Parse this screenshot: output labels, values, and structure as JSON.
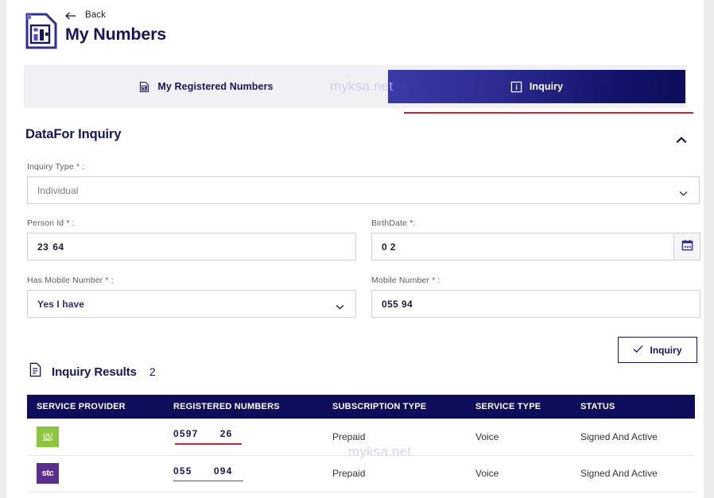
{
  "header": {
    "back_label": "Back",
    "title": "My Numbers",
    "doc_icon": "document-chart-icon",
    "back_icon": "arrow-left-icon"
  },
  "tabs": [
    {
      "label": "My Registered Numbers",
      "icon": "document-list-icon",
      "active": false
    },
    {
      "label": "Inquiry",
      "icon": "info-square-icon",
      "active": true
    }
  ],
  "watermarks": [
    "myksa.net",
    "myksa.net",
    "myksa.net"
  ],
  "section": {
    "title": "DataFor Inquiry",
    "collapse_icon": "chevron-up-icon"
  },
  "form": {
    "inquiry_type": {
      "label": "Inquiry Type * :",
      "value": "Individual",
      "options": [
        "Individual"
      ],
      "chevron_icon": "chevron-down-icon"
    },
    "person_id": {
      "label": "Person Id * :",
      "value": "23             64"
    },
    "birth_date": {
      "label": "BirthDate *:",
      "value": "0             2",
      "calendar_icon": "calendar-icon"
    },
    "has_mobile": {
      "label": "Has Mobile Number * :",
      "value": "Yes I have",
      "options": [
        "Yes I have"
      ],
      "chevron_icon": "chevron-down-icon"
    },
    "mobile_number": {
      "label": "Mobile Number * :",
      "value": "055          94"
    }
  },
  "inquiry_button": {
    "label": "Inquiry",
    "icon": "check-icon"
  },
  "results": {
    "icon": "document-icon",
    "title": "Inquiry Results",
    "count": "2",
    "columns": [
      "SERVICE PROVIDER",
      "REGISTERED NUMBERS",
      "SUBSCRIPTION TYPE",
      "SERVICE TYPE",
      "STATUS"
    ],
    "rows": [
      {
        "provider": "zain",
        "provider_ar": "زين",
        "provider_en": "zain",
        "number": "0597      26",
        "subscription_type": "Prepaid",
        "service_type": "Voice",
        "status": "Signed And Active"
      },
      {
        "provider": "stc",
        "provider_ar": "",
        "provider_en": "stc",
        "number": "055      094",
        "subscription_type": "Prepaid",
        "service_type": "Voice",
        "status": "Signed And Active"
      }
    ]
  },
  "colors": {
    "navy": "#16165c",
    "dark_navy": "#0d0d5c",
    "red": "#d8232a",
    "tab_bg": "#f0f0f5",
    "zain_green": "#8cc63e",
    "stc_purple": "#5b2d8e"
  }
}
